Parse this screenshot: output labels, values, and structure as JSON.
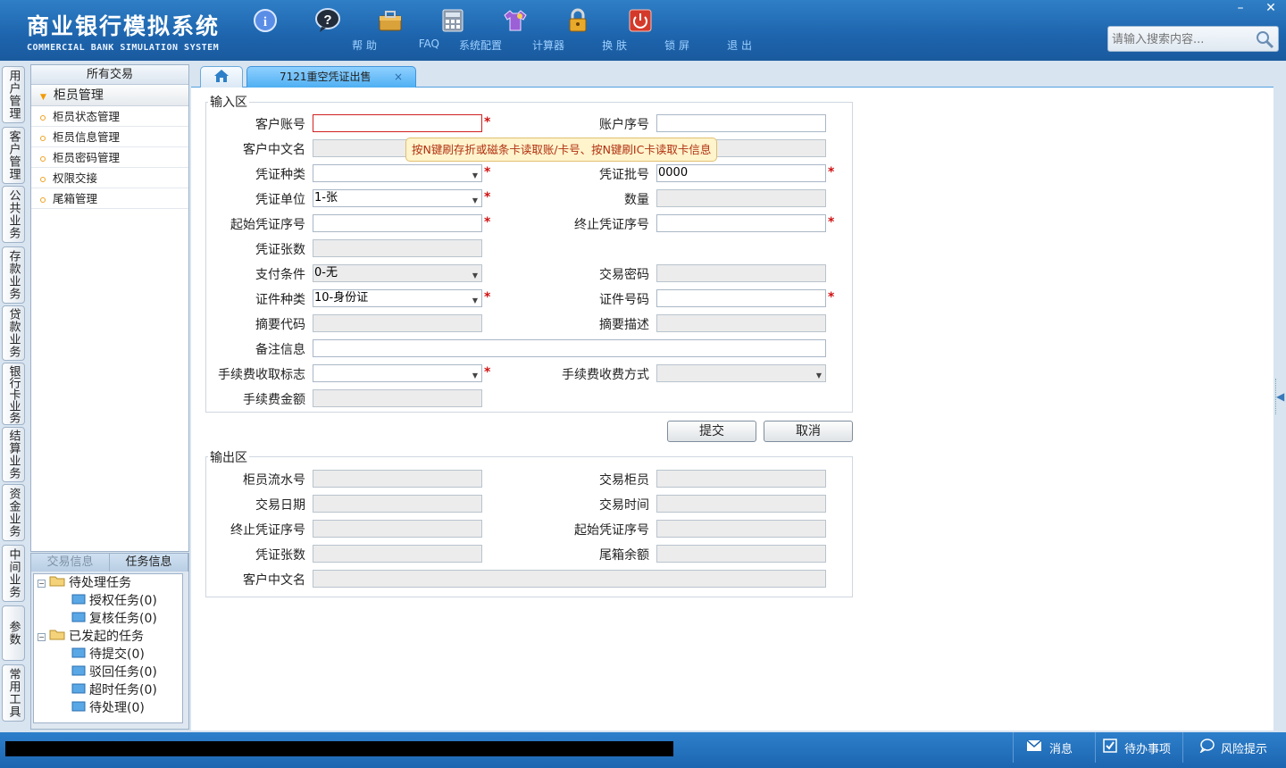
{
  "app": {
    "title_cn": "商业银行模拟系统",
    "title_en": "COMMERCIAL BANK SIMULATION SYSTEM",
    "window_controls": {
      "minimize": "–",
      "close": "✕"
    }
  },
  "toolbar": [
    {
      "label": "帮 助",
      "icon": "info-icon"
    },
    {
      "label": "FAQ",
      "icon": "question-icon"
    },
    {
      "label": "系统配置",
      "icon": "toolbox-icon"
    },
    {
      "label": "计算器",
      "icon": "calculator-icon"
    },
    {
      "label": "换 肤",
      "icon": "shirt-icon"
    },
    {
      "label": "锁 屏",
      "icon": "lock-icon"
    },
    {
      "label": "退 出",
      "icon": "power-icon"
    }
  ],
  "search": {
    "placeholder": "请输入搜索内容..."
  },
  "vertical_tabs": [
    "用户管理",
    "客户管理",
    "公共业务",
    "存款业务",
    "贷款业务",
    "银行卡业务",
    "结算业务",
    "资金业务",
    "中间业务",
    "参数",
    "常用工具"
  ],
  "menu": {
    "header": "所有交易",
    "group": "柜员管理",
    "items": [
      "柜员状态管理",
      "柜员信息管理",
      "柜员密码管理",
      "权限交接",
      "尾箱管理"
    ]
  },
  "tasks": {
    "tabs": [
      "交易信息",
      "任务信息"
    ],
    "pending_root": "待处理任务",
    "pending": [
      "授权任务(0)",
      "复核任务(0)"
    ],
    "initiated_root": "已发起的任务",
    "initiated": [
      "待提交(0)",
      "驳回任务(0)",
      "超时任务(0)",
      "待处理(0)"
    ]
  },
  "tabs": {
    "active": "7121重空凭证出售",
    "close": "×"
  },
  "input_section": {
    "title": "输入区",
    "tooltip": "按N键刷存折或磁条卡读取账/卡号、按N键刷IC卡读取卡信息",
    "labels": {
      "cust_account": "客户账号",
      "account_seq": "账户序号",
      "cust_cn_name": "客户中文名",
      "voucher_type": "凭证种类",
      "voucher_batch": "凭证批号",
      "voucher_unit": "凭证单位",
      "quantity": "数量",
      "start_seq": "起始凭证序号",
      "end_seq": "终止凭证序号",
      "voucher_count": "凭证张数",
      "pay_condition": "支付条件",
      "trade_password": "交易密码",
      "id_type": "证件种类",
      "id_number": "证件号码",
      "summary_code": "摘要代码",
      "summary_desc": "摘要描述",
      "remarks": "备注信息",
      "fee_flag": "手续费收取标志",
      "fee_method": "手续费收费方式",
      "fee_amount": "手续费金额"
    },
    "values": {
      "voucher_batch": "0000",
      "voucher_unit": "1-张",
      "pay_condition": "0-无",
      "id_type": "10-身份证"
    },
    "required_mark": "*"
  },
  "buttons": {
    "submit": "提交",
    "cancel": "取消"
  },
  "output_section": {
    "title": "输出区",
    "labels": {
      "teller_serial": "柜员流水号",
      "trade_teller": "交易柜员",
      "trade_date": "交易日期",
      "trade_time": "交易时间",
      "end_seq": "终止凭证序号",
      "start_seq": "起始凭证序号",
      "voucher_count": "凭证张数",
      "box_balance": "尾箱余额",
      "cust_cn_name": "客户中文名"
    }
  },
  "statusbar": {
    "messages": "消息",
    "todo": "待办事项",
    "risk": "风险提示"
  }
}
